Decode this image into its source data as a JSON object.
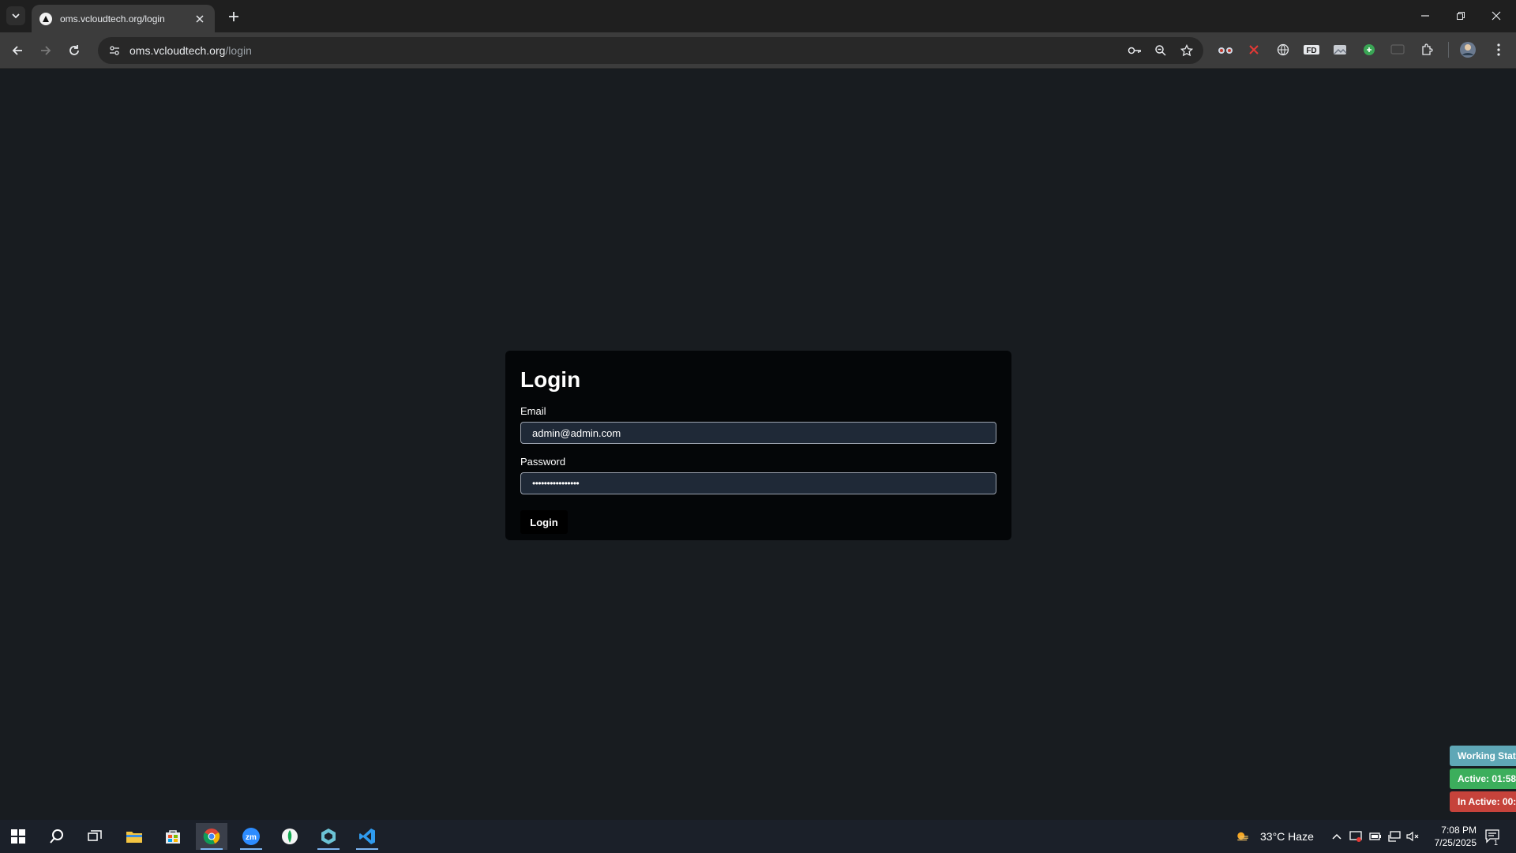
{
  "browser": {
    "tab_title": "oms.vcloudtech.org/login",
    "url_host": "oms.vcloudtech.org",
    "url_path": "/login"
  },
  "login_card": {
    "title": "Login",
    "email_label": "Email",
    "email_value": "admin@admin.com",
    "password_label": "Password",
    "password_value": "••••••••••••••••",
    "submit_label": "Login"
  },
  "working_status": {
    "header": "Working Stat",
    "active": "Active: 01:58",
    "inactive": "In Active: 00:",
    "colors": {
      "header": "#5fa7b6",
      "active": "#3cae5c",
      "inactive": "#c6433b"
    }
  },
  "taskbar": {
    "weather": "33°C  Haze",
    "time": "7:08 PM",
    "date": "7/25/2025",
    "notifications_count": "1"
  }
}
